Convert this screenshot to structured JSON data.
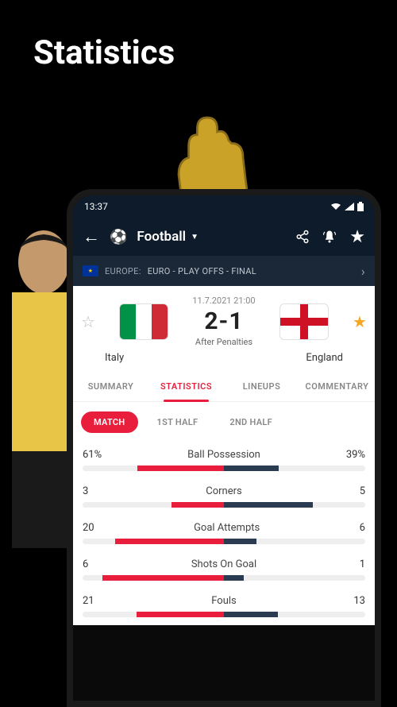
{
  "page": {
    "title": "Statistics"
  },
  "status": {
    "time": "13:37"
  },
  "header": {
    "sport": "Football"
  },
  "competition": {
    "region": "EUROPE:",
    "name": "EURO - PLAY OFFS - FINAL"
  },
  "match": {
    "date": "11.7.2021 21:00",
    "score": "2-1",
    "note": "After Penalties",
    "home": "Italy",
    "away": "England"
  },
  "tabs": {
    "summary": "SUMMARY",
    "statistics": "STATISTICS",
    "lineups": "LINEUPS",
    "commentary": "COMMENTARY"
  },
  "periods": {
    "match": "MATCH",
    "first": "1ST HALF",
    "second": "2ND HALF"
  },
  "stats": [
    {
      "label": "Ball Possession",
      "home": "61%",
      "away": "39%",
      "homePct": 61,
      "awayPct": 39
    },
    {
      "label": "Corners",
      "home": "3",
      "away": "5",
      "homePct": 37,
      "awayPct": 63
    },
    {
      "label": "Goal Attempts",
      "home": "20",
      "away": "6",
      "homePct": 77,
      "awayPct": 23
    },
    {
      "label": "Shots On Goal",
      "home": "6",
      "away": "1",
      "homePct": 86,
      "awayPct": 14
    },
    {
      "label": "Fouls",
      "home": "21",
      "away": "13",
      "homePct": 62,
      "awayPct": 38
    }
  ]
}
